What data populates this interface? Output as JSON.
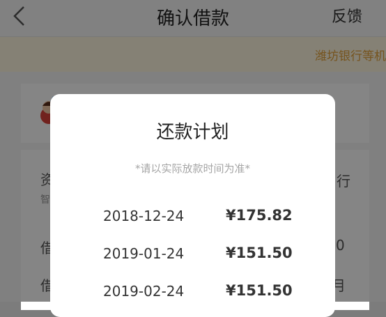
{
  "nav": {
    "title": "确认借款",
    "right_label": "反馈"
  },
  "notice": {
    "text": "潍坊银行等机"
  },
  "background": {
    "row1_label": "资",
    "row1_sub": "智",
    "row1_right": "行",
    "row2_label": "借",
    "row2_right": "0",
    "row3_label": "借",
    "row3_right": "月"
  },
  "modal": {
    "title": "还款计划",
    "note": "*请以实际放款时间为准*",
    "plan": [
      {
        "date": "2018-12-24",
        "amount": "¥175.82"
      },
      {
        "date": "2019-01-24",
        "amount": "¥151.50"
      },
      {
        "date": "2019-02-24",
        "amount": "¥151.50"
      }
    ]
  },
  "colors": {
    "notice_text": "#e2a23a",
    "notice_bg": "#fff8e1",
    "avatar_red": "#d9423a"
  }
}
